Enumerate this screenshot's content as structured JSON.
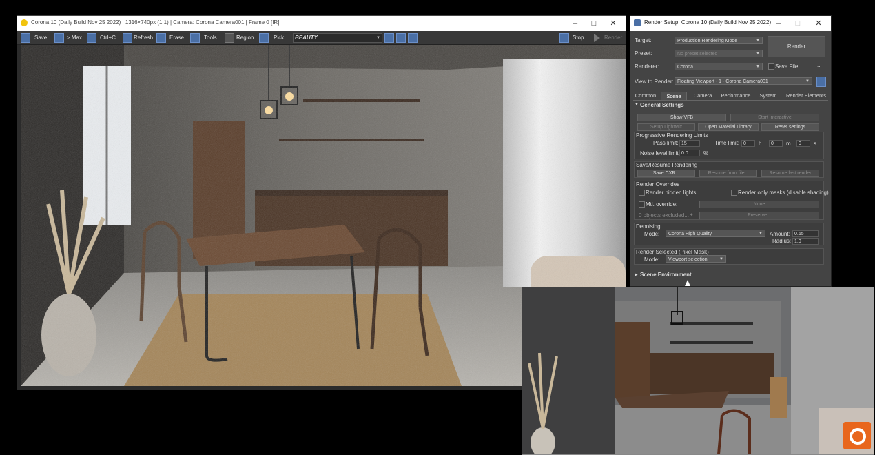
{
  "vfb": {
    "title": "Corona 10 (Daily Build Nov 25 2022) | 1316×740px (1:1) | Camera: Corona Camera001 | Frame 0 [IR]",
    "toolbar": {
      "save": "Save",
      "max": "> Max",
      "copy": "Ctrl+C",
      "refresh": "Refresh",
      "erase": "Erase",
      "tools": "Tools",
      "region": "Region",
      "pick": "Pick",
      "pass": "BEAUTY",
      "stop": "Stop",
      "render": "Render"
    }
  },
  "render_setup": {
    "title": "Render Setup: Corona 10 (Daily Build Nov 25 2022)",
    "target_label": "Target:",
    "target_value": "Production Rendering Mode",
    "preset_label": "Preset:",
    "preset_value": "No preset selected",
    "renderer_label": "Renderer:",
    "renderer_value": "Corona",
    "save_file": "Save File",
    "view_label": "View to Render:",
    "view_value": "Floating Viewport - 1 - Corona Camera001",
    "render_button": "Render",
    "more": "...",
    "tabs": [
      "Common",
      "Scene",
      "Camera",
      "Performance",
      "System",
      "Render Elements"
    ],
    "active_tab": "Scene",
    "general_settings": {
      "header": "General Settings",
      "show_vfb": "Show VFB",
      "start_interactive": "Start interactive",
      "setup_lightmix": "Setup LightMix",
      "open_material_library": "Open Material Library",
      "reset_settings": "Reset settings",
      "progressive_header": "Progressive Rendering Limits",
      "pass_limit_label": "Pass limit:",
      "pass_limit": "15",
      "time_limit_label": "Time limit:",
      "time_h": "0",
      "h": "h",
      "time_m": "0",
      "m": "m",
      "time_s": "0",
      "s": "s",
      "noise_label": "Noise level limit:",
      "noise_value": "0.0",
      "percent": "%",
      "save_resume_header": "Save/Resume Rendering",
      "save_cxr": "Save CXR...",
      "resume_from_file": "Resume from file...",
      "resume_last": "Resume last render",
      "overrides_header": "Render Overrides",
      "render_hidden_lights": "Render hidden lights",
      "render_only_masks": "Render only masks (disable shading)",
      "mtl_override": "Mtl. override:",
      "none": "None",
      "objects_excluded": "0 objects excluded...",
      "plus": "+",
      "preserve": "Preserve...",
      "denoising_header": "Denoising",
      "mode_label": "Mode:",
      "denoise_mode": "Corona High Quality",
      "amount_label": "Amount:",
      "amount": "0.65",
      "radius_label": "Radius:",
      "radius": "1.0",
      "render_selected_header": "Render Selected (Pixel Mask)",
      "rs_mode_label": "Mode:",
      "rs_mode": "Viewport selection"
    },
    "scene_environment": "Scene Environment"
  },
  "colors": {
    "accent": "#4a6fa5",
    "corona_orange": "#e8661c",
    "panel": "#444444"
  }
}
